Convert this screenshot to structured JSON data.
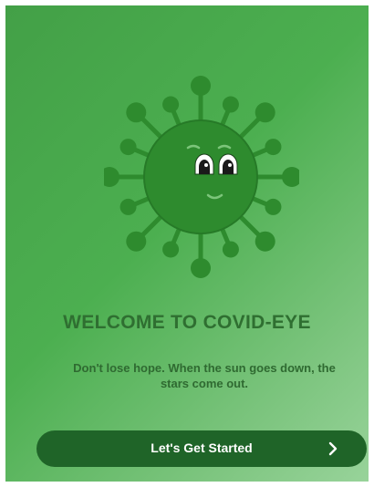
{
  "welcome": {
    "title": "WELCOME TO COVID-EYE",
    "message": "Don't lose hope. When the sun goes down, the stars come out."
  },
  "actions": {
    "get_started_label": "Let's Get Started",
    "get_started_icon": "chevron-right-icon"
  },
  "mascot": {
    "icon": "virus-mascot-icon"
  },
  "colors": {
    "background_start": "#43a047",
    "background_end": "#98d39a",
    "virus_body": "#2e8b2e",
    "title_text": "#2f6f31",
    "button": "#1f6428",
    "button_text": "#ffffff"
  }
}
